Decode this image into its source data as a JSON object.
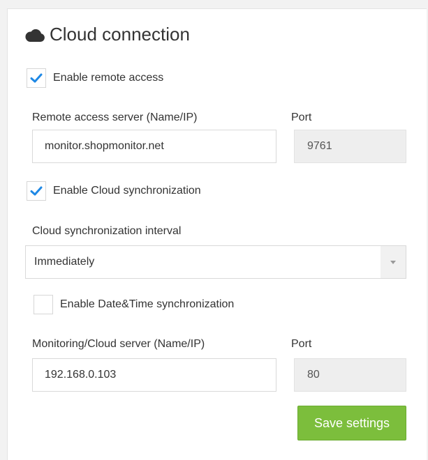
{
  "title": "Cloud connection",
  "title_icon": "cloud-icon",
  "accent_color": "#1e88e5",
  "save_color": "#7cbe3c",
  "remote_access": {
    "enable_label": "Enable remote access",
    "enabled": true,
    "server_label": "Remote access server (Name/IP)",
    "server_value": "monitor.shopmonitor.net",
    "port_label": "Port",
    "port_value": "9761"
  },
  "cloud_sync": {
    "enable_label": "Enable Cloud synchronization",
    "enabled": true,
    "interval_label": "Cloud synchronization interval",
    "interval_value": "Immediately"
  },
  "datetime_sync": {
    "enable_label": "Enable Date&Time synchronization",
    "enabled": false
  },
  "monitoring": {
    "server_label": "Monitoring/Cloud server (Name/IP)",
    "server_value": "192.168.0.103",
    "port_label": "Port",
    "port_value": "80"
  },
  "save_label": "Save settings"
}
